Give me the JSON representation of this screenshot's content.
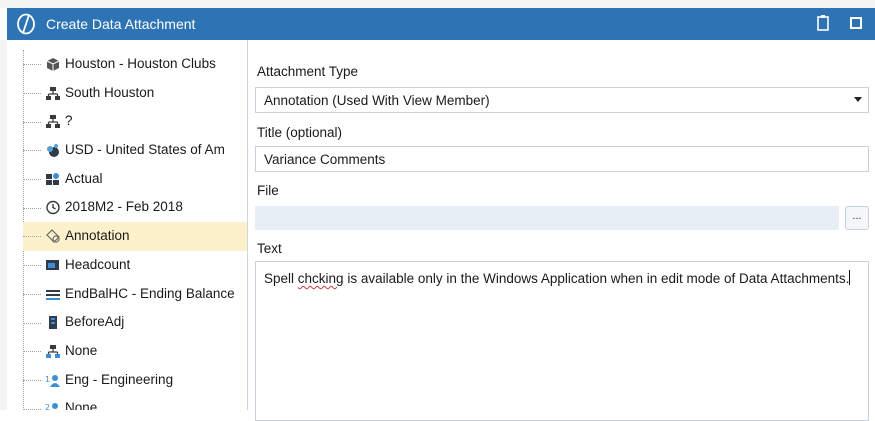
{
  "window": {
    "title": "Create Data Attachment",
    "logo_icon": "onestream-logo-icon",
    "buttons": [
      "clipboard-icon",
      "maximize-icon"
    ]
  },
  "tree": {
    "items": [
      {
        "label": "Houston - Houston Clubs",
        "icon": "cube-icon",
        "selected": false
      },
      {
        "label": "South Houston",
        "icon": "org-chart-icon",
        "selected": false
      },
      {
        "label": "?",
        "icon": "org-chart-icon",
        "selected": false
      },
      {
        "label": "USD - United States of Am",
        "icon": "currency-icon",
        "selected": false
      },
      {
        "label": "Actual",
        "icon": "scenario-icon",
        "selected": false
      },
      {
        "label": "2018M2 - Feb 2018",
        "icon": "clock-icon",
        "selected": false
      },
      {
        "label": "Annotation",
        "icon": "view-icon",
        "selected": true
      },
      {
        "label": "Headcount",
        "icon": "account-icon",
        "selected": false
      },
      {
        "label": "EndBalHC - Ending Balance",
        "icon": "flow-icon",
        "selected": false
      },
      {
        "label": "BeforeAdj",
        "icon": "origin-icon",
        "selected": false
      },
      {
        "label": "None",
        "icon": "ic-icon",
        "selected": false
      },
      {
        "label": "Eng - Engineering",
        "icon": "ud1-icon",
        "selected": false
      },
      {
        "label": "None",
        "icon": "ud2-icon",
        "selected": false
      }
    ]
  },
  "form": {
    "attachment_type_label": "Attachment Type",
    "attachment_type_value": "Annotation (Used With View Member)",
    "title_label": "Title (optional)",
    "title_value": "Variance Comments",
    "file_label": "File",
    "file_value": "",
    "browse_label": "...",
    "text_label": "Text",
    "text_part1": "Spell ",
    "text_misspelled": "chcking",
    "text_part2": " is available only in the Windows Application when in edit mode of Data Attachments."
  },
  "colors": {
    "titlebar": "#2e74b5",
    "selected_row": "#fdf1cc",
    "file_field": "#e8eef6"
  }
}
